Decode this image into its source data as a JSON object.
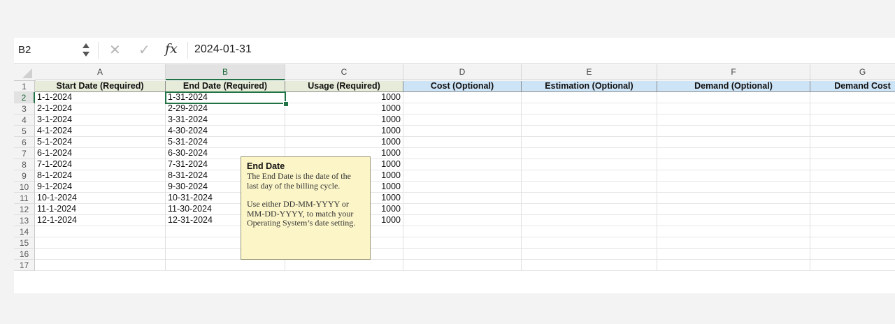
{
  "formula_bar": {
    "name_box": "B2",
    "formula_value": "2024-01-31"
  },
  "columns": [
    "A",
    "B",
    "C",
    "D",
    "E",
    "F",
    "G"
  ],
  "header_row": [
    "Start Date (Required)",
    "End Date (Required)",
    "Usage (Required)",
    "Cost (Optional)",
    "Estimation (Optional)",
    "Demand (Optional)",
    "Demand Cost"
  ],
  "rows": [
    {
      "num": "1"
    },
    {
      "num": "2",
      "a": "1-1-2024",
      "b": "1-31-2024",
      "c": "1000"
    },
    {
      "num": "3",
      "a": "2-1-2024",
      "b": "2-29-2024",
      "c": "1000"
    },
    {
      "num": "4",
      "a": "3-1-2024",
      "b": "3-31-2024",
      "c": "1000"
    },
    {
      "num": "5",
      "a": "4-1-2024",
      "b": "4-30-2024",
      "c": "1000"
    },
    {
      "num": "6",
      "a": "5-1-2024",
      "b": "5-31-2024",
      "c": "1000"
    },
    {
      "num": "7",
      "a": "6-1-2024",
      "b": "6-30-2024",
      "c": "1000"
    },
    {
      "num": "8",
      "a": "7-1-2024",
      "b": "7-31-2024",
      "c": "1000"
    },
    {
      "num": "9",
      "a": "8-1-2024",
      "b": "8-31-2024",
      "c": "1000"
    },
    {
      "num": "10",
      "a": "9-1-2024",
      "b": "9-30-2024",
      "c": "1000"
    },
    {
      "num": "11",
      "a": "10-1-2024",
      "b": "10-31-2024",
      "c": "1000"
    },
    {
      "num": "12",
      "a": "11-1-2024",
      "b": "11-30-2024",
      "c": "1000"
    },
    {
      "num": "13",
      "a": "12-1-2024",
      "b": "12-31-2024",
      "c": "1000"
    },
    {
      "num": "14"
    },
    {
      "num": "15"
    },
    {
      "num": "16"
    },
    {
      "num": "17"
    }
  ],
  "selected_cell": "B2",
  "comment": {
    "title": "End Date",
    "para1": "The End Date is the date of the last day of the billing cycle.",
    "para2": "Use either DD-MM-YYYY or MM-DD-YYYY, to match your Operating System’s date setting."
  },
  "colors": {
    "required_header": "#e6ecd9",
    "optional_header": "#cde3f6",
    "selection": "#217346",
    "comment_bg": "#fbf5c8"
  },
  "icons": [
    "stepper-icon",
    "cancel-icon",
    "confirm-icon",
    "fx-icon"
  ]
}
